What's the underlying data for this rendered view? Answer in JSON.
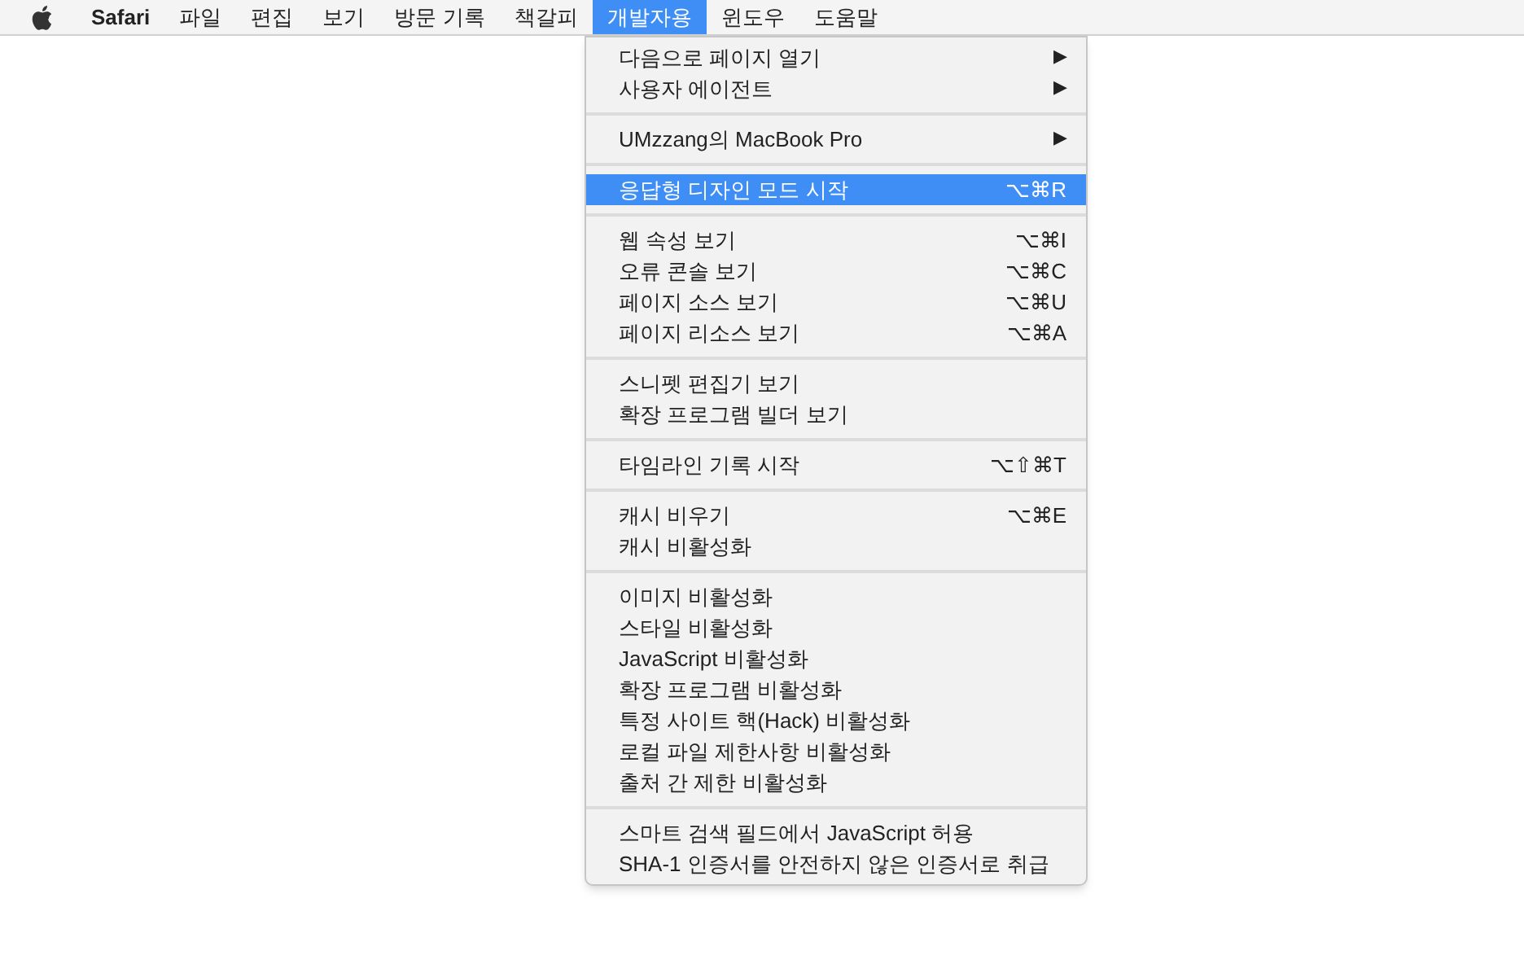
{
  "menu_bar": [
    {
      "label": "Safari",
      "kind": "app",
      "selected": false
    },
    {
      "label": "파일",
      "kind": "menu",
      "selected": false
    },
    {
      "label": "편집",
      "kind": "menu",
      "selected": false
    },
    {
      "label": "보기",
      "kind": "menu",
      "selected": false
    },
    {
      "label": "방문 기록",
      "kind": "menu",
      "selected": false
    },
    {
      "label": "책갈피",
      "kind": "menu",
      "selected": false
    },
    {
      "label": "개발자용",
      "kind": "menu",
      "selected": true
    },
    {
      "label": "윈도우",
      "kind": "menu",
      "selected": false
    },
    {
      "label": "도움말",
      "kind": "menu",
      "selected": false
    }
  ],
  "menu": {
    "groups": [
      [
        {
          "label": "다음으로 페이지 열기",
          "arrow": "▶",
          "selected": false
        },
        {
          "label": "사용자 에이전트",
          "arrow": "▶",
          "selected": false
        }
      ],
      [
        {
          "label": "UMzzang의 MacBook Pro",
          "arrow": "▶",
          "selected": false
        }
      ],
      [
        {
          "label": "응답형 디자인 모드 시작",
          "shortcut": "⌥⌘R",
          "selected": true
        }
      ],
      [
        {
          "label": "웹 속성 보기",
          "shortcut": "⌥⌘I",
          "selected": false
        },
        {
          "label": "오류 콘솔 보기",
          "shortcut": "⌥⌘C",
          "selected": false
        },
        {
          "label": "페이지 소스 보기",
          "shortcut": "⌥⌘U",
          "selected": false
        },
        {
          "label": "페이지 리소스 보기",
          "shortcut": "⌥⌘A",
          "selected": false
        }
      ],
      [
        {
          "label": "스니펫 편집기 보기",
          "selected": false
        },
        {
          "label": "확장 프로그램 빌더 보기",
          "selected": false
        }
      ],
      [
        {
          "label": "타임라인 기록 시작",
          "shortcut": "⌥⇧⌘T",
          "selected": false
        }
      ],
      [
        {
          "label": "캐시 비우기",
          "shortcut": "⌥⌘E",
          "selected": false
        },
        {
          "label": "캐시 비활성화",
          "selected": false
        }
      ],
      [
        {
          "label": "이미지 비활성화",
          "selected": false
        },
        {
          "label": "스타일 비활성화",
          "selected": false
        },
        {
          "label": "JavaScript 비활성화",
          "selected": false
        },
        {
          "label": "확장 프로그램 비활성화",
          "selected": false
        },
        {
          "label": "특정 사이트 핵(Hack) 비활성화",
          "selected": false
        },
        {
          "label": "로컬 파일 제한사항 비활성화",
          "selected": false
        },
        {
          "label": "출처 간 제한 비활성화",
          "selected": false
        }
      ],
      [
        {
          "label": "스마트 검색 필드에서 JavaScript 허용",
          "selected": false
        },
        {
          "label": "SHA-1 인증서를 안전하지 않은 인증서로 취급",
          "selected": false
        }
      ]
    ]
  }
}
